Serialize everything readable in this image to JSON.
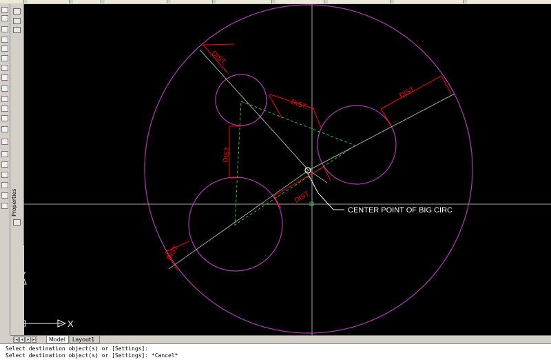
{
  "canvas": {
    "annotations": {
      "dist": "DIST.",
      "center_label": "CENTER POINT OF BIG CIRC"
    },
    "ucs": {
      "x_label": "X",
      "y_label": "Y"
    },
    "colors": {
      "background": "#000000",
      "circle": "#b13ab6",
      "dimension": "#ff0000",
      "triangle": "#2fbf3a",
      "lines": "#a8a8a8"
    }
  },
  "palette": {
    "label": "Properties"
  },
  "tabs": {
    "model": "Model",
    "layout1": "Layout1"
  },
  "command_line": {
    "line1": "Select destination object(s) or [Settings]:",
    "line2": "Select destination object(s) or [Settings]: *Cancel*"
  }
}
